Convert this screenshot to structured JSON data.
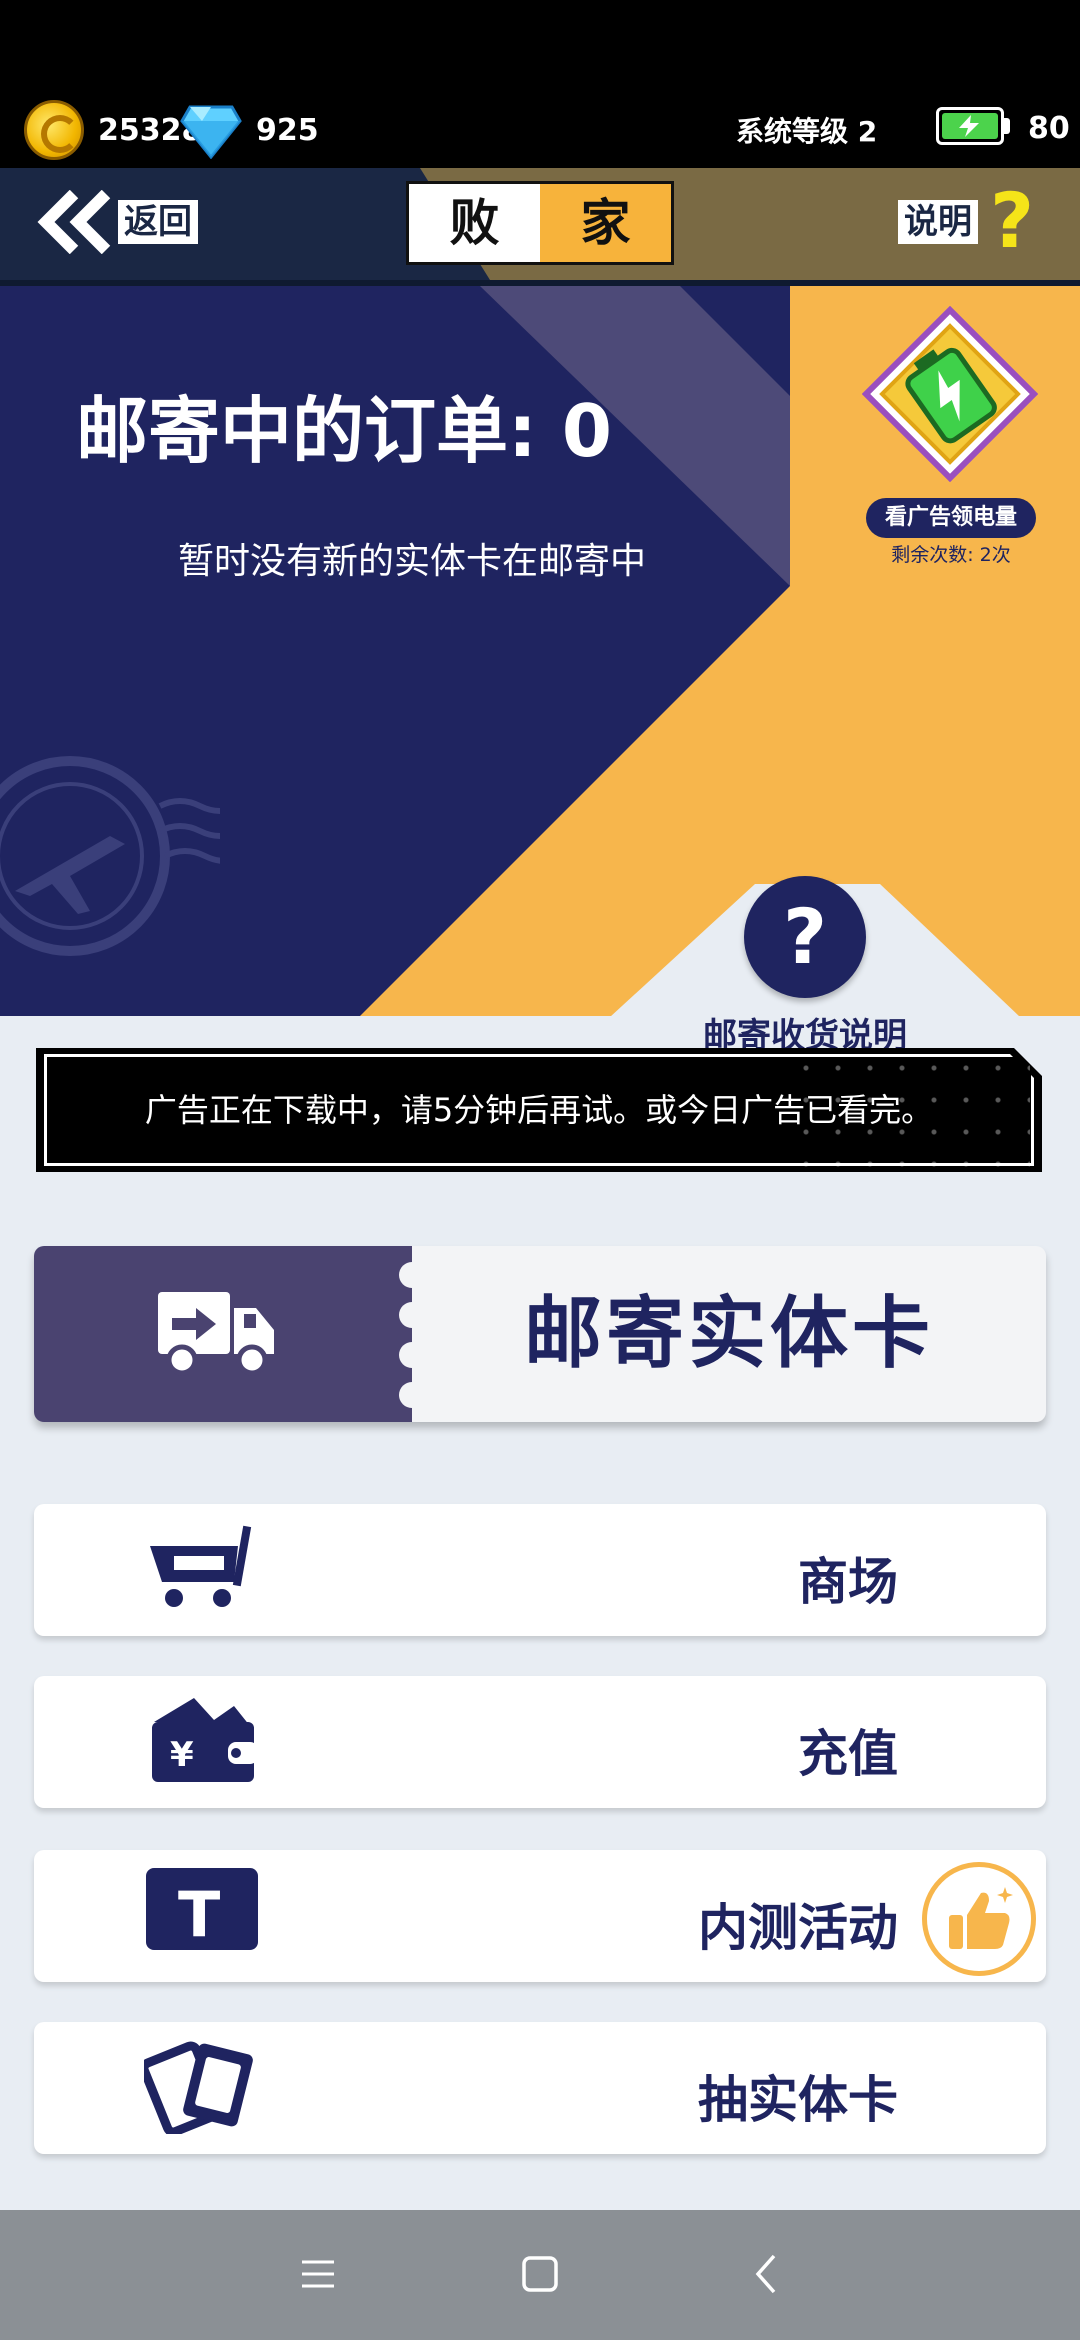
{
  "status": {
    "coins": "25328",
    "gems": "925",
    "system_level": "系统等级 2",
    "battery": "80"
  },
  "header": {
    "back_label": "返回",
    "tab_left": "败",
    "tab_right": "家",
    "help_label": "说明"
  },
  "hero": {
    "title": "邮寄中的订单: 0",
    "subtitle": "暂时没有新的实体卡在邮寄中",
    "reward_button": "看广告领电量",
    "reward_remaining": "剩余次数: 2次",
    "help_mark": "?",
    "help_text": "邮寄收货说明"
  },
  "notice": {
    "text": "广告正在下载中，请5分钟后再试。或今日广告已看完。"
  },
  "mail_button": {
    "label": "邮寄实体卡"
  },
  "menu": [
    {
      "label": "商场",
      "icon": "cart-icon"
    },
    {
      "label": "充值",
      "icon": "wallet-icon"
    },
    {
      "label": "内测活动",
      "icon": "t-badge-icon"
    },
    {
      "label": "抽实体卡",
      "icon": "cards-icon"
    }
  ],
  "menu_icon_text": {
    "wallet_symbol": "¥",
    "t_letter": "T"
  },
  "colors": {
    "navy": "#1f2460",
    "orange": "#f7b64c",
    "purple": "#4a4370"
  }
}
